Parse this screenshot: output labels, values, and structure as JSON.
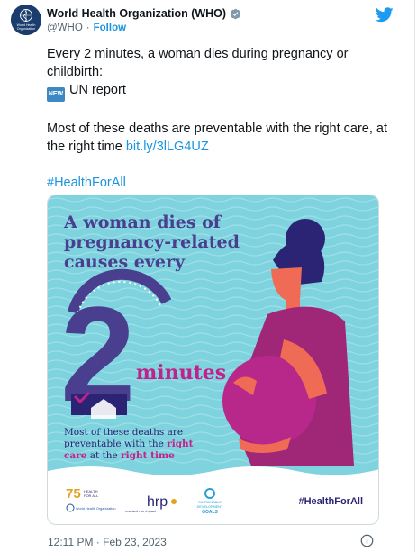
{
  "tweet": {
    "display_name": "World Health Organization (WHO)",
    "handle": "@WHO",
    "separator": "·",
    "follow_label": "Follow",
    "text_line1": "Every 2 minutes, a woman dies during pregnancy or childbirth:",
    "badge_label": "NEW",
    "text_line2": "UN report",
    "text_line3": "Most of these deaths are preventable with the right care, at the right time",
    "link_text": "bit.ly/3lLG4UZ",
    "hashtag": "#HealthForAll",
    "timestamp": "12:11 PM · Feb 23, 2023"
  },
  "avatar": {
    "logo_text_line1": "World Health",
    "logo_text_line2": "Organization"
  },
  "infographic": {
    "headline_line1": "A woman dies of",
    "headline_line2": "pregnancy-related",
    "headline_line3": "causes every",
    "big_number": "2",
    "unit_word": "minutes",
    "note_line1": "Most of these deaths are",
    "note_line2_a": "preventable with the ",
    "note_line2_b": "right",
    "note_line3_a": "care",
    "note_line3_b": " at the ",
    "note_line3_c": "right time",
    "hashtag": "#HealthForAll",
    "logo_75": "75",
    "logo_75_sub1": "HEALTH",
    "logo_75_sub2": "FOR ALL",
    "logo_who": "World Health Organization",
    "logo_hrp": "hrp",
    "logo_hrp_sub": "research for impact",
    "logo_sdg_line1": "SUSTAINABLE",
    "logo_sdg_line2": "DEVELOPMENT",
    "logo_sdg_line3": "GOALS"
  },
  "colors": {
    "bg_teal": "#7fd3de",
    "navy": "#4a3f8e",
    "magenta": "#c2208a",
    "skin": "#ef6b55",
    "hair": "#2b2474",
    "link_blue": "#1b95e0"
  },
  "icons": {
    "twitter": "twitter-bird-icon",
    "verified": "verified-badge-icon",
    "info": "info-icon"
  }
}
